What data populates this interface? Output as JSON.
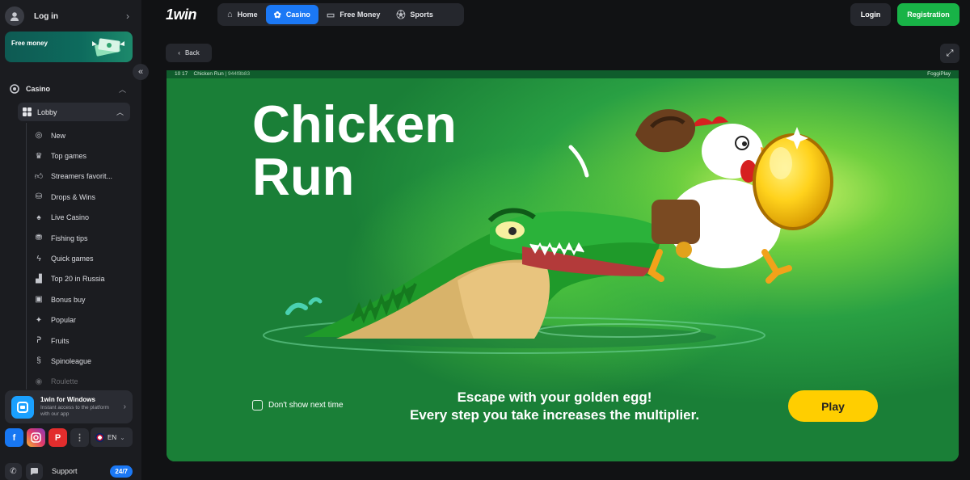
{
  "sidebar": {
    "login_label": "Log in",
    "free_money_banner": "Free money",
    "casino_label": "Casino",
    "lobby_label": "Lobby",
    "menu": [
      {
        "label": "New",
        "icon": "new-icon"
      },
      {
        "label": "Top games",
        "icon": "crown-icon"
      },
      {
        "label": "Streamers favorit...",
        "icon": "thumbs-up-icon"
      },
      {
        "label": "Drops & Wins",
        "icon": "coins-icon"
      },
      {
        "label": "Live Casino",
        "icon": "spade-icon"
      },
      {
        "label": "Fishing tips",
        "icon": "fish-icon"
      },
      {
        "label": "Quick games",
        "icon": "lightning-icon"
      },
      {
        "label": "Top 20 in Russia",
        "icon": "podium-icon"
      },
      {
        "label": "Bonus buy",
        "icon": "gift-icon"
      },
      {
        "label": "Popular",
        "icon": "sparkle-icon"
      },
      {
        "label": "Fruits",
        "icon": "cherry-icon"
      },
      {
        "label": "Spinoleague",
        "icon": "league-icon"
      },
      {
        "label": "Roulette",
        "icon": "roulette-icon"
      }
    ],
    "windows_app": {
      "title": "1win for Windows",
      "subtitle": "Instant access to the platform with our app"
    },
    "language": "EN",
    "support_label": "Support",
    "support_badge": "24/7"
  },
  "header": {
    "logo": "1win",
    "tabs": [
      {
        "label": "Home",
        "icon": "home-icon",
        "active": false
      },
      {
        "label": "Casino",
        "icon": "casino-chip-icon",
        "active": true
      },
      {
        "label": "Free Money",
        "icon": "money-icon",
        "active": false
      },
      {
        "label": "Sports",
        "icon": "soccer-ball-icon",
        "active": false
      }
    ],
    "login_label": "Login",
    "registration_label": "Registration"
  },
  "game_bar": {
    "back_label": "Back",
    "meta_time": "10 17",
    "meta_title": "Chicken Run",
    "meta_id": "| 944f8b83",
    "provider": "FoggiPlay"
  },
  "game": {
    "title_line1": "Chicken",
    "title_line2": "Run",
    "dont_show_label": "Don't show next time",
    "tagline_line1": "Escape with your golden egg!",
    "tagline_line2": "Every step you take increases the multiplier.",
    "play_label": "Play"
  },
  "colors": {
    "accent_blue": "#1b78f5",
    "registration_green": "#18b347",
    "play_yellow": "#ffce00",
    "game_green": "#1f8a3b"
  }
}
